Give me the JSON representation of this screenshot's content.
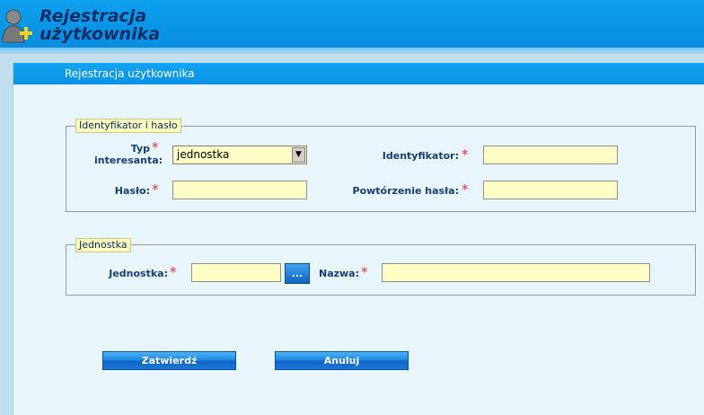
{
  "header": {
    "title_line1": "Rejestracja",
    "title_line2": "użytkownika",
    "icon": "user-add-icon"
  },
  "panel": {
    "title": "Rejestracja użytkownika"
  },
  "section_credentials": {
    "legend": "Identyfikator i hasło",
    "type_label_line1": "Typ",
    "type_label_line2": "interesanta:",
    "type_value": "jednostka",
    "identifier_label": "Identyfikator:",
    "identifier_value": "",
    "password_label": "Hasło:",
    "password_value": "",
    "repeat_password_label": "Powtórzenie hasła:",
    "repeat_password_value": ""
  },
  "section_unit": {
    "legend": "Jednostka",
    "unit_label": "Jednostka:",
    "unit_value": "",
    "browse_label": "...",
    "name_label": "Nazwa:",
    "name_value": ""
  },
  "required_mark": "*",
  "buttons": {
    "confirm": "Zatwierdź",
    "cancel": "Anuluj"
  },
  "colors": {
    "accent": "#0a92e4",
    "input_bg": "#ffffc6",
    "label": "#1a3f73",
    "required": "#e0303e"
  }
}
